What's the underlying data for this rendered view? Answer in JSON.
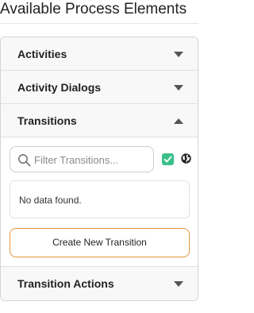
{
  "page": {
    "title": "Available Process Elements"
  },
  "sections": {
    "activities": {
      "label": "Activities",
      "caret": "chevron-down-icon"
    },
    "activity_dialogs": {
      "label": "Activity Dialogs",
      "caret": "chevron-down-icon"
    },
    "transitions": {
      "label": "Transitions",
      "caret": "chevron-up-icon"
    },
    "transition_actions": {
      "label": "Transition Actions",
      "caret": "chevron-down-icon"
    }
  },
  "transitions_panel": {
    "search": {
      "placeholder": "Filter Transitions...",
      "value": ""
    },
    "filter_checkbox_checked": true,
    "empty_message": "No data found.",
    "create_button_label": "Create New Transition"
  },
  "colors": {
    "accent_border": "#e2963c",
    "checkbox": "#3cc08a",
    "header_bg": "#f8f8f8"
  }
}
